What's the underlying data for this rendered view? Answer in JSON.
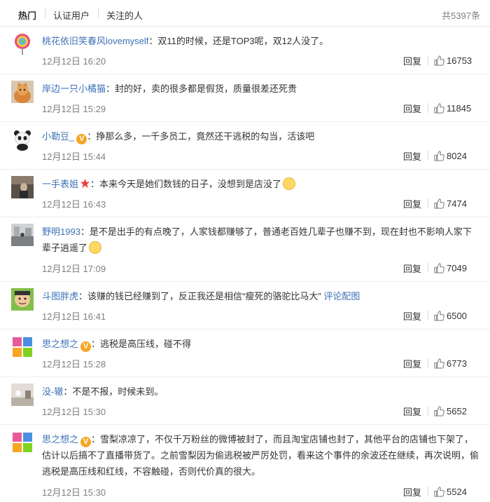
{
  "tabs": [
    {
      "label": "热门",
      "active": true
    },
    {
      "label": "认证用户",
      "active": false
    },
    {
      "label": "关注的人",
      "active": false
    }
  ],
  "total": "共5397条",
  "reply_label": "回复",
  "comments": [
    {
      "user": "桃花依旧笑春风lovemyself",
      "text": "：双11的时候，还是TOP3呢，双12人没了。",
      "time": "12月12日 16:20",
      "likes": "16753",
      "avatar": "lollipop-avatar"
    },
    {
      "user": "岸边一只小橘猫",
      "text": "：封的好，卖的很多都是假货，质量很差还死贵",
      "time": "12月12日 15:29",
      "likes": "11845",
      "avatar": "cat-avatar"
    },
    {
      "user": "小勒豆_",
      "text": "：挣那么多，一千多员工，竟然还干逃税的勾当，活该吧",
      "time": "12月12日 15:44",
      "likes": "8024",
      "avatar": "panda-avatar"
    },
    {
      "user": "一手表姐",
      "text": "：本来今天是她们数钱的日子，没想到是店没了",
      "time": "12月12日 16:43",
      "likes": "7474",
      "avatar": "dark-photo-avatar"
    },
    {
      "user": "野明1993",
      "text": "：是不是出手的有点晚了，人家钱都赚够了，普通老百姓几辈子也赚不到，现在封也不影响人家下辈子逍遥了",
      "time": "12月12日 17:09",
      "likes": "7049",
      "avatar": "street-photo-avatar"
    },
    {
      "user": "斗图胖虎",
      "text": "：该赚的钱已经赚到了，反正我还是相信“瘦死的骆驼比马大”",
      "link": "评论配图",
      "time": "12月12日 16:41",
      "likes": "6500",
      "avatar": "cartoon-avatar"
    },
    {
      "user": "思之想之",
      "text": "：逃税是高压线，碰不得",
      "time": "12月12日 15:28",
      "likes": "6773",
      "avatar": "sizhi-avatar"
    },
    {
      "user": "没-辙",
      "text": "：不是不报，时候未到。",
      "time": "12月12日 15:30",
      "likes": "5652",
      "avatar": "room-photo-avatar"
    },
    {
      "user": "思之想之",
      "text": "：雪梨凉凉了，不仅千万粉丝的微博被封了，而且淘宝店铺也封了，其他平台的店铺也下架了，估计以后搞不了直播带货了。之前雪梨因为偷逃税被严厉处罚，看来这个事件的余波还在继续，再次说明，偷逃税是高压线和红线，不容触碰，否则代价真的很大。",
      "time": "12月12日 15:30",
      "likes": "5524",
      "avatar": "sizhi-avatar"
    }
  ]
}
